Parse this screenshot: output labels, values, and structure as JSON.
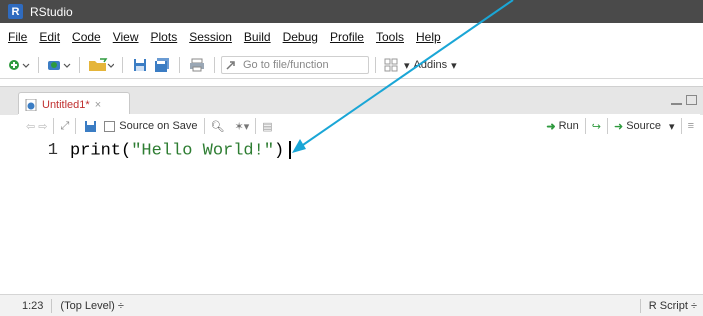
{
  "window": {
    "title": "RStudio",
    "logo_letter": "R"
  },
  "menu": [
    "File",
    "Edit",
    "Code",
    "View",
    "Plots",
    "Session",
    "Build",
    "Debug",
    "Profile",
    "Tools",
    "Help"
  ],
  "toolbar": {
    "goto_placeholder": "Go to file/function",
    "addins_label": "Addins"
  },
  "tab": {
    "label": "Untitled1*",
    "close": "×"
  },
  "editor_toolbar": {
    "source_on_save": "Source on Save",
    "run": "Run",
    "source": "Source"
  },
  "code": {
    "line_number": "1",
    "func": "print(",
    "string": "\"Hello World!\"",
    "close": ")"
  },
  "status": {
    "position": "1:23",
    "scope": "(Top Level) ÷",
    "filetype": "R Script ÷"
  },
  "colors": {
    "titlebar": "#4a4a4a",
    "tab_text": "#c03030",
    "string": "#2e7d32",
    "arrow": "#1aa6d6"
  }
}
